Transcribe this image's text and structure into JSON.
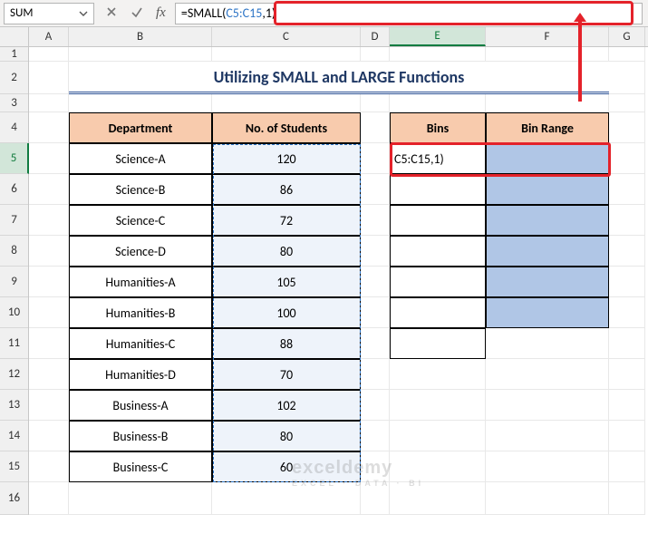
{
  "name_box": "SUM",
  "formula": {
    "raw": "=SMALL(C5:C15,1)",
    "eq": "=",
    "fn": "SMALL(",
    "ref": "C5:C15",
    "comma": ",",
    "num": "1",
    "close": ")"
  },
  "columns": [
    "A",
    "B",
    "C",
    "D",
    "E",
    "F",
    "G"
  ],
  "rows": [
    "1",
    "2",
    "3",
    "4",
    "5",
    "6",
    "7",
    "8",
    "9",
    "10",
    "11",
    "12",
    "13",
    "14",
    "15",
    "16"
  ],
  "title": "Utilizing SMALL and LARGE Functions",
  "headers": {
    "department": "Department",
    "students": "No. of Students",
    "bins": "Bins",
    "binrange": "Bin Range"
  },
  "table": [
    {
      "dept": "Science-A",
      "n": "120"
    },
    {
      "dept": "Science-B",
      "n": "86"
    },
    {
      "dept": "Science-C",
      "n": "72"
    },
    {
      "dept": "Science-D",
      "n": "80"
    },
    {
      "dept": "Humanities-A",
      "n": "105"
    },
    {
      "dept": "Humanities-B",
      "n": "100"
    },
    {
      "dept": "Humanities-C",
      "n": "88"
    },
    {
      "dept": "Humanities-D",
      "n": "70"
    },
    {
      "dept": "Business-A",
      "n": "102"
    },
    {
      "dept": "Business-B",
      "n": "80"
    },
    {
      "dept": "Business-C",
      "n": "60"
    }
  ],
  "e5_display": "C5:C15,1)",
  "watermark": {
    "main": "exceldemy",
    "sub": "EXCEL · DATA · BI"
  },
  "selected_col": "E",
  "selected_row": "5"
}
